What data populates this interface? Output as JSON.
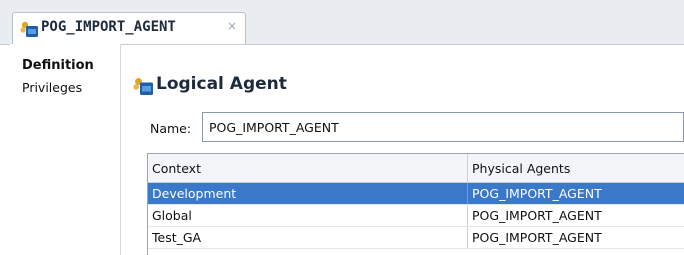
{
  "tab": {
    "title": "POG_IMPORT_AGENT",
    "close": "×",
    "icon": "logical-agent-icon"
  },
  "nav": {
    "items": [
      "Definition",
      "Privileges"
    ]
  },
  "main": {
    "heading": "Logical Agent",
    "heading_icon": "logical-agent-icon",
    "name_label": "Name:",
    "name_value": "POG_IMPORT_AGENT"
  },
  "table": {
    "columns": [
      "Context",
      "Physical Agents"
    ],
    "rows": [
      [
        "Development",
        "POG_IMPORT_AGENT"
      ],
      [
        "Global",
        "POG_IMPORT_AGENT"
      ],
      [
        "Test_GA",
        "POG_IMPORT_AGENT"
      ]
    ],
    "selected_row": "Development"
  },
  "colors": {
    "selection": "#3a78c9",
    "icon_blue": "#1f5fa8",
    "icon_gold": "#e0a526"
  }
}
